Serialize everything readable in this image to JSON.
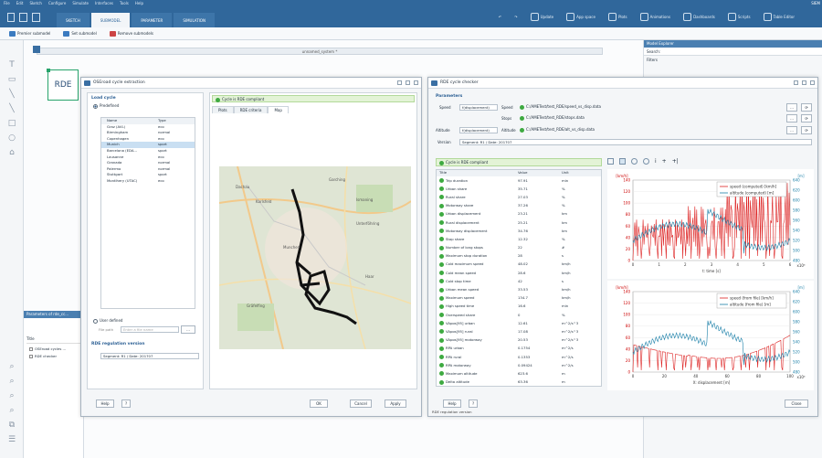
{
  "menu": [
    "File",
    "Edit",
    "Sketch",
    "Configure",
    "Simulate",
    "Interfaces",
    "Tools",
    "Help"
  ],
  "brand": "SIEM",
  "tabs": [
    {
      "label": "SKETCH"
    },
    {
      "label": "SUBMODEL"
    },
    {
      "label": "PARAMETER"
    },
    {
      "label": "SIMULATION"
    }
  ],
  "toolbar_right": [
    "Update",
    "App space",
    "Plots",
    "Animations",
    "Dashboards",
    "Scripts",
    "Table Editor"
  ],
  "subtoolbar": [
    "Premier submodel",
    "Set submodel",
    "Remove submodels"
  ],
  "document_tab": "unnamed_system *",
  "rde_block": "RDE",
  "left_panel": {
    "title": "Parameters of rde_cc...",
    "col": "Title",
    "items": [
      "OSEroad cycles ...",
      "RDE checker"
    ]
  },
  "right_panel": {
    "title": "Model Explorer",
    "search": "Search:",
    "filters": "Filters"
  },
  "extraction": {
    "title": "OSEroad cycle extraction",
    "load_cycle": "Load cycle",
    "predefined": "Predefined",
    "cols": [
      "Name",
      "Type"
    ],
    "rows": [
      [
        "Graz (AVL)",
        "eco"
      ],
      [
        "Birmingham",
        "normal"
      ],
      [
        "Copenhagen",
        "eco"
      ],
      [
        "Munich",
        "sport"
      ],
      [
        "Barcelona (EDA...",
        "sport"
      ],
      [
        "Lausanne",
        "eco"
      ],
      [
        "Granada",
        "normal"
      ],
      [
        "Palermo",
        "normal"
      ],
      [
        "Stuttgart",
        "sport"
      ],
      [
        "Montlhery (UTAC)",
        "eco"
      ]
    ],
    "selected_index": 3,
    "user_defined": "User defined",
    "file_label": "File path",
    "file_placeholder": "Enter a file name",
    "reg_title": "RDE regulation version",
    "reg_value": "Segment: R1 / Date: 201707",
    "status": "Cycle is RDE compliant",
    "view_tabs": [
      "Plots",
      "RDE criteria",
      "Map"
    ],
    "active_tab": "Map",
    "map_labels": [
      "Dachau",
      "Karlsfeld",
      "Munchen",
      "Unterföhring",
      "Haar",
      "Gräfelfing",
      "Ismaning",
      "Garching"
    ],
    "help": "Help",
    "ok": "OK",
    "cancel": "Cancel",
    "apply": "Apply"
  },
  "checker": {
    "title": "RDE cycle checker",
    "params_title": "Parameters",
    "speed_label": "Speed",
    "speed_select": "f(displacement)",
    "speed_sub": "Speed",
    "speed_path": "C:/AMETest/test_RDE/speed_vs_disp.data",
    "stops_label": "Stops",
    "stops_path": "C:/AMETest/test_RDE/stops.data",
    "alt_label": "Altitude",
    "alt_select": "f(displacement)",
    "alt_sub": "Altitude",
    "alt_path": "C:/AMETest/test_RDE/alt_vs_disp.data",
    "version_label": "Version",
    "version_value": "Segment: R1 / Date: 201707",
    "status": "Cycle is RDE compliant",
    "cols": [
      "Title",
      "Value",
      "Unit"
    ],
    "rows": [
      [
        "Trip duration",
        "97.91",
        "min"
      ],
      [
        "Urban share",
        "35.71",
        "%"
      ],
      [
        "Rural share",
        "27.03",
        "%"
      ],
      [
        "Motorway share",
        "37.26",
        "%"
      ],
      [
        "Urban displacement",
        "23.21",
        "km"
      ],
      [
        "Rural displacement",
        "25.21",
        "km"
      ],
      [
        "Motorway displacement",
        "34.76",
        "km"
      ],
      [
        "Stop share",
        "12.32",
        "%"
      ],
      [
        "Number of long stops",
        "22",
        "#"
      ],
      [
        "Maximum stop duration",
        "28",
        "s"
      ],
      [
        "Cold maximum speed",
        "48.02",
        "km/h"
      ],
      [
        "Cold mean speed",
        "28.6",
        "km/h"
      ],
      [
        "Cold stop time",
        "42",
        "s"
      ],
      [
        "Urban mean speed",
        "33.53",
        "km/h"
      ],
      [
        "Maximum speed",
        "134.7",
        "km/h"
      ],
      [
        "High speed time",
        "16.6",
        "min"
      ],
      [
        "Overspeed share",
        "0",
        "%"
      ],
      [
        "VApos[95] urban",
        "12.61",
        "m^2/s^3"
      ],
      [
        "VApos[95] rural",
        "17.08",
        "m^2/s^3"
      ],
      [
        "VApos[95] motorway",
        "20.53",
        "m^2/s^3"
      ],
      [
        "RPA urban",
        "0.1754",
        "m^2/s"
      ],
      [
        "RPA rural",
        "0.1353",
        "m^2/s"
      ],
      [
        "RPA motorway",
        "0.09424",
        "m^2/s"
      ],
      [
        "Maximum altitude",
        "623.6",
        "m"
      ],
      [
        "Delta altitude",
        "63.36",
        "m"
      ]
    ],
    "help": "Help",
    "reg_status": "RDE regulation version",
    "close": "Close"
  },
  "chart_data": [
    {
      "type": "line",
      "legend": [
        "speed (computed) [km/h]",
        "altitude (computed) [m]"
      ],
      "xlabel": "t: time [s]",
      "ylabel": "[km/h]",
      "ylabel2": "[m]",
      "y_ticks": [
        "140",
        "120",
        "100",
        "80",
        "60",
        "40",
        "20",
        "0"
      ],
      "y2_ticks": [
        "640",
        "620",
        "600",
        "580",
        "560",
        "540",
        "520",
        "500",
        "480"
      ],
      "x_ticks": [
        "0",
        "1",
        "2",
        "3",
        "4",
        "5",
        "6"
      ],
      "x_mult": "x10³"
    },
    {
      "type": "line",
      "legend": [
        "speed (from file) [km/h]",
        "altitude (from file) [m]"
      ],
      "xlabel": "X: displacement [m]",
      "ylabel": "[km/h]",
      "ylabel2": "[m]",
      "y_ticks": [
        "140",
        "120",
        "100",
        "80",
        "60",
        "40",
        "20",
        "0"
      ],
      "y2_ticks": [
        "640",
        "620",
        "600",
        "580",
        "560",
        "540",
        "520",
        "500",
        "480"
      ],
      "x_ticks": [
        "0",
        "20",
        "40",
        "60",
        "80",
        "100"
      ],
      "x_mult": "x10³"
    }
  ]
}
